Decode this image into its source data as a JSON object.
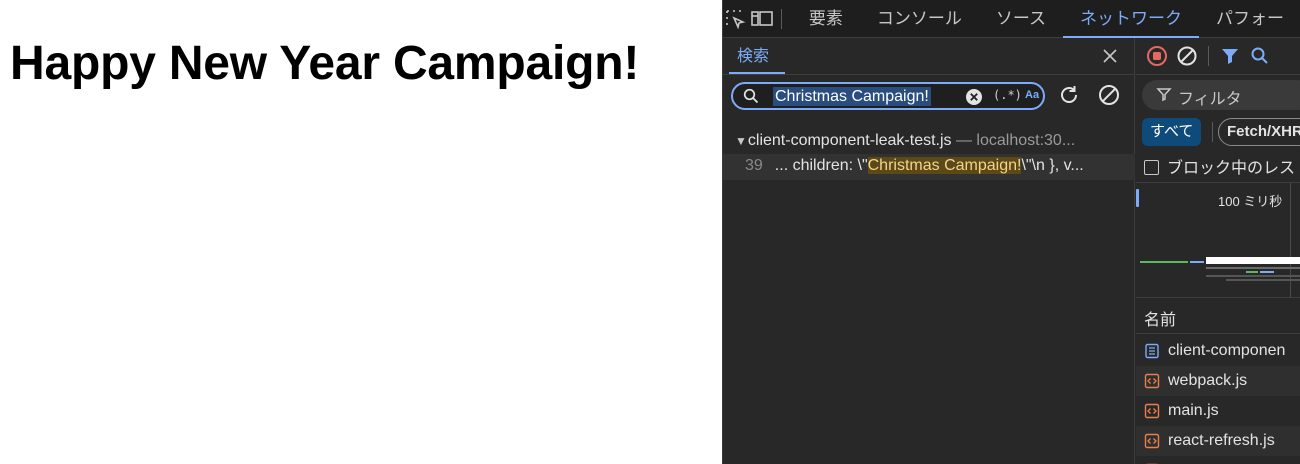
{
  "page": {
    "heading": "Happy New Year Campaign!"
  },
  "devtools": {
    "tabs": [
      "要素",
      "コンソール",
      "ソース",
      "ネットワーク",
      "パフォー"
    ],
    "active_tab": "ネットワーク",
    "search": {
      "title": "検索",
      "query": "Christmas Campaign!",
      "regex_label": "(.*)",
      "case_label": "Aa",
      "results": {
        "file_name": "client-component-leak-test.js",
        "file_origin": "— localhost:30...",
        "line_number": "39",
        "line_prefix": "... children: \\\"",
        "line_match": "Christmas Campaign!",
        "line_suffix": "\\\"\\n }, v..."
      }
    },
    "network": {
      "filter_placeholder": "フィルタ",
      "type_all": "すべて",
      "type_fetch": "Fetch/XHR",
      "block_label": "ブロック中のレス",
      "overview_label": "100 ミリ秒",
      "column_name": "名前",
      "requests": [
        {
          "name": "client-componen",
          "kind": "document"
        },
        {
          "name": "webpack.js",
          "kind": "script"
        },
        {
          "name": "main.js",
          "kind": "script"
        },
        {
          "name": "react-refresh.js",
          "kind": "script"
        }
      ]
    },
    "colors": {
      "accent": "#7cacf8",
      "record": "#e46962",
      "script_icon": "#e8804a",
      "highlight_bg": "#5b4a17"
    }
  }
}
